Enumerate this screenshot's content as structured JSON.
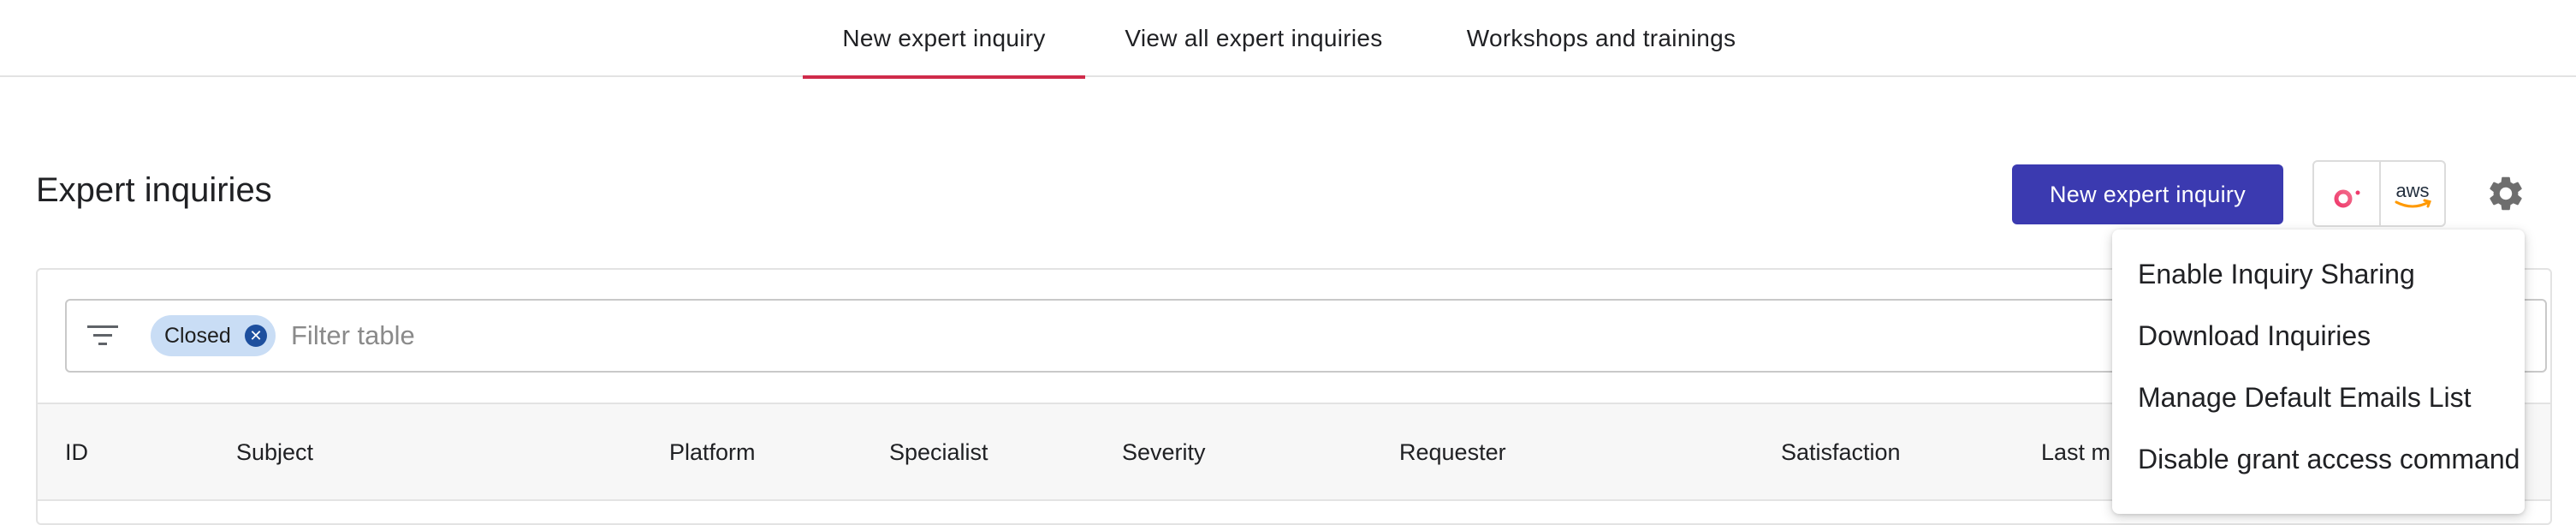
{
  "nav": {
    "tabs": [
      {
        "label": "New expert inquiry",
        "active": true
      },
      {
        "label": "View all expert inquiries",
        "active": false
      },
      {
        "label": "Workshops and trainings",
        "active": false
      }
    ],
    "active_color": "#cf2b4a"
  },
  "header": {
    "title": "Expert inquiries",
    "new_button_label": "New expert inquiry",
    "accent_color": "#3b3ab0",
    "integrations": [
      {
        "name": "doit-logo-icon"
      },
      {
        "name": "aws-logo-icon",
        "text": "aws"
      }
    ],
    "settings_icon": "gear-icon"
  },
  "filter": {
    "icon": "filter-list-icon",
    "chips": [
      {
        "label": "Closed"
      }
    ],
    "placeholder": "Filter table",
    "value": ""
  },
  "table": {
    "columns": [
      "ID",
      "Subject",
      "Platform",
      "Specialist",
      "Severity",
      "Requester",
      "Satisfaction",
      "Last m"
    ]
  },
  "settings_menu": {
    "items": [
      "Enable Inquiry Sharing",
      "Download Inquiries",
      "Manage Default Emails List",
      "Disable grant access command"
    ]
  }
}
